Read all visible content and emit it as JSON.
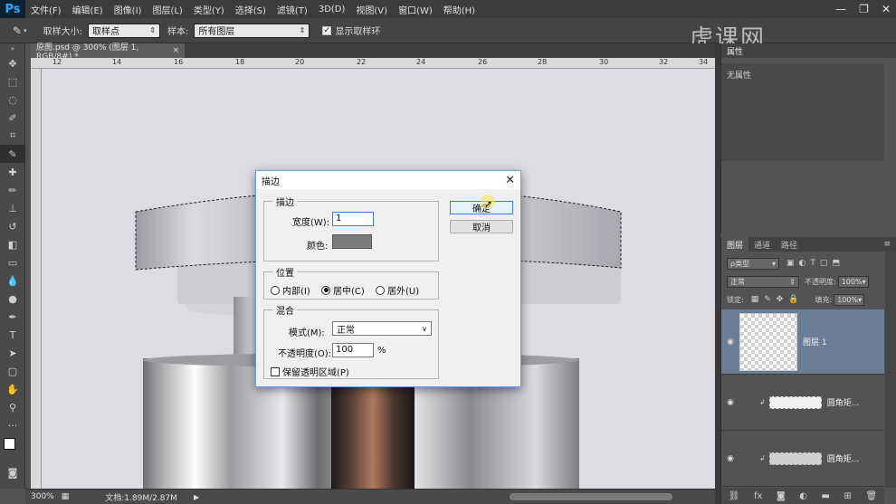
{
  "app": {
    "logo": "Ps"
  },
  "menu": [
    "文件(F)",
    "编辑(E)",
    "图像(I)",
    "图层(L)",
    "类型(Y)",
    "选择(S)",
    "滤镜(T)",
    "3D(D)",
    "视图(V)",
    "窗口(W)",
    "帮助(H)"
  ],
  "window_controls": {
    "minimize": "—",
    "restore": "❐",
    "close": "✕"
  },
  "options": {
    "sample_size_label": "取样大小:",
    "sample_size_value": "取样点",
    "sample_label": "样本:",
    "sample_value": "所有图层",
    "show_ring_label": "显示取样环",
    "show_ring_checked": true
  },
  "watermark": "虎课网",
  "document": {
    "tab_title": "原图.psd @ 300% (图层 1, RGB/8#) *",
    "tab_close": "×",
    "ruler_marks": [
      "12",
      "14",
      "16",
      "18",
      "20",
      "22",
      "24",
      "26",
      "28",
      "30",
      "32",
      "34"
    ]
  },
  "status": {
    "zoom": "300%",
    "doc_size": "文档:1.89M/2.87M"
  },
  "properties": {
    "tab": "属性",
    "empty": "无属性"
  },
  "layers": {
    "tabs": [
      "图层",
      "通道",
      "路径"
    ],
    "kind_filter": "ρ类型",
    "blend_mode": "正常",
    "opacity_label": "不透明度:",
    "opacity_value": "100%",
    "lock_label": "锁定:",
    "fill_label": "填充:",
    "fill_value": "100%",
    "items": [
      {
        "name": "图层 1",
        "selected": true
      },
      {
        "name": "圆角矩...",
        "selected": false
      },
      {
        "name": "圆角矩...",
        "selected": false
      }
    ]
  },
  "dialog": {
    "title": "描边",
    "close": "✕",
    "stroke_group": "描边",
    "width_label": "宽度(W):",
    "width_value": "1",
    "color_label": "颜色:",
    "color_value": "#7b7b7b",
    "location_group": "位置",
    "location_options": [
      "内部(I)",
      "居中(C)",
      "居外(U)"
    ],
    "location_selected": "居中(C)",
    "blend_group": "混合",
    "mode_label": "模式(M):",
    "mode_value": "正常",
    "opacity_label": "不透明度(O):",
    "opacity_value": "100",
    "opacity_unit": "%",
    "preserve_label": "保留透明区域(P)",
    "preserve_checked": false,
    "ok": "确定",
    "cancel": "取消"
  }
}
